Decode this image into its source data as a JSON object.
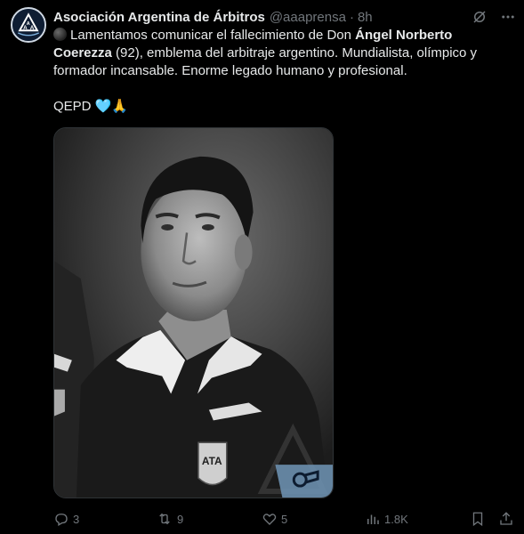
{
  "tweet": {
    "display_name": "Asociación Argentina de Árbitros",
    "handle": "@aaaprensa",
    "separator": "·",
    "time": "8h",
    "text_part1": "Lamentamos comunicar el fallecimiento de Don ",
    "text_bold1": "Ángel Norberto Coerezza",
    "text_part2": " (92), emblema del arbitraje argentino. Mundialista, olímpico y formador incansable. Enorme legado humano y profesional.",
    "text_part3": "QEPD",
    "emoji_heart": "🩵",
    "emoji_pray": "🙏"
  },
  "actions": {
    "replies": "3",
    "reposts": "9",
    "likes": "5",
    "views": "1.8K"
  },
  "icons": {
    "grok": "grok-icon",
    "more": "more-icon",
    "reply": "reply-icon",
    "retweet": "retweet-icon",
    "like": "heart-icon",
    "views": "views-icon",
    "bookmark": "bookmark-icon",
    "share": "share-icon"
  },
  "colors": {
    "background": "#000000",
    "text": "#e7e9ea",
    "muted": "#71767b",
    "border": "#2f3336"
  }
}
